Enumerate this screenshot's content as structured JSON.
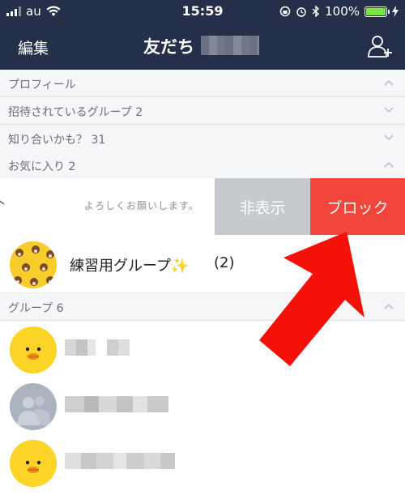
{
  "status_bar": {
    "carrier": "au",
    "time": "15:59",
    "battery_percent": "100%",
    "battery_level": 1.0
  },
  "nav": {
    "edit_label": "編集",
    "title": "友だち"
  },
  "sections": [
    {
      "label": "プロフィール",
      "expanded": true
    },
    {
      "label": "招待されているグループ 2",
      "expanded": false
    },
    {
      "label": "知り合いかも？ 31",
      "expanded": false
    },
    {
      "label": "お気に入り 2",
      "expanded": true
    }
  ],
  "favorite_swiped": {
    "status_message": "よろしくお願いします。",
    "hide_label": "非表示",
    "block_label": "ブロック"
  },
  "group": {
    "name": "練習用グループ✨",
    "count": "(2)"
  },
  "groups_section": {
    "label": "グループ 6",
    "expanded": true
  },
  "colors": {
    "nav_bg": "#243049",
    "hide_bg": "#c6c9cd",
    "block_bg": "#f2453c",
    "arrow": "#f5100a",
    "battery": "#7ee24a"
  }
}
